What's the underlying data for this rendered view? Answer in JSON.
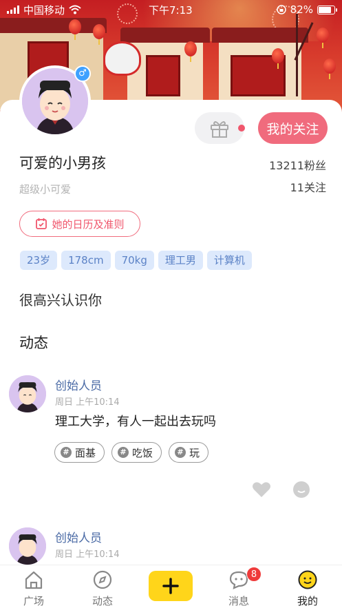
{
  "status_bar": {
    "carrier": "中国移动",
    "time": "下午7:13",
    "battery": "82%",
    "battery_level": 0.82
  },
  "profile": {
    "follow_button": "我的关注",
    "name": "可爱的小男孩",
    "signature": "超级小可爱",
    "fans": "13211粉丝",
    "following": "11关注",
    "calendar_button": "她的日历及准则",
    "tags": [
      "23岁",
      "178cm",
      "70kg",
      "理工男",
      "计算机"
    ],
    "intro": "很高兴认识你",
    "gender_symbol": "♂"
  },
  "feed": {
    "section_title": "动态",
    "posts": [
      {
        "author": "创始人员",
        "time": "周日 上午10:14",
        "text": "理工大学，有人一起出去玩吗",
        "topics": [
          "面基",
          "吃饭",
          "玩"
        ]
      },
      {
        "author": "创始人员",
        "time": "周日 上午10:14"
      }
    ]
  },
  "tabbar": {
    "items": [
      {
        "label": "广场",
        "icon": "home-icon"
      },
      {
        "label": "动态",
        "icon": "compass-icon"
      },
      {
        "label": "",
        "icon": "plus-icon"
      },
      {
        "label": "消息",
        "icon": "chat-icon"
      },
      {
        "label": "我的",
        "icon": "smiley-icon"
      }
    ],
    "message_badge": "8",
    "active": "我的"
  },
  "colors": {
    "accent_pink": "#f06b7d",
    "tag_bg": "#dde9fc",
    "tag_text": "#5b82c6",
    "plus_yellow": "#ffd51a",
    "author_blue": "#4a6aa5"
  }
}
